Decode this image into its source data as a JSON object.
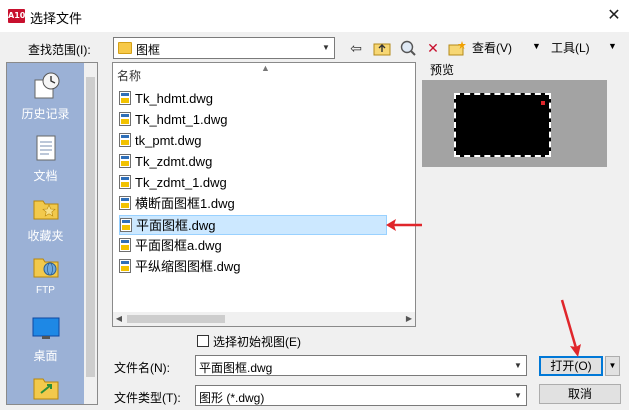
{
  "window": {
    "title": "选择文件",
    "app_icon_text": "A10"
  },
  "toolbar": {
    "look_in_label": "查找范围(I):",
    "look_in_value": "图框",
    "view_label": "查看(V)",
    "tools_label": "工具(L)"
  },
  "places": [
    {
      "label": "历史记录",
      "icon": "history-icon"
    },
    {
      "label": "文档",
      "icon": "documents-icon"
    },
    {
      "label": "收藏夹",
      "icon": "favorites-icon"
    },
    {
      "label": "FTP",
      "icon": "ftp-icon"
    },
    {
      "label": "桌面",
      "icon": "desktop-icon"
    }
  ],
  "file_list": {
    "column_header": "名称",
    "files": [
      "Tk_hdmt.dwg",
      "Tk_hdmt_1.dwg",
      "tk_pmt.dwg",
      "Tk_zdmt.dwg",
      "Tk_zdmt_1.dwg",
      "横断面图框1.dwg",
      "平面图框.dwg",
      "平面图框a.dwg",
      "平纵缩图图框.dwg"
    ],
    "selected_index": 6
  },
  "preview": {
    "label": "预览"
  },
  "options": {
    "initial_view_label": "选择初始视图(E)",
    "initial_view_checked": false
  },
  "form": {
    "filename_label": "文件名(N):",
    "filename_value": "平面图框.dwg",
    "filetype_label": "文件类型(T):",
    "filetype_value": "图形 (*.dwg)",
    "open_label": "打开(O)",
    "cancel_label": "取消"
  },
  "colors": {
    "annotation_arrow": "#e0262b",
    "selection": "#cce8ff",
    "places_bg": "#9bb1d6"
  }
}
